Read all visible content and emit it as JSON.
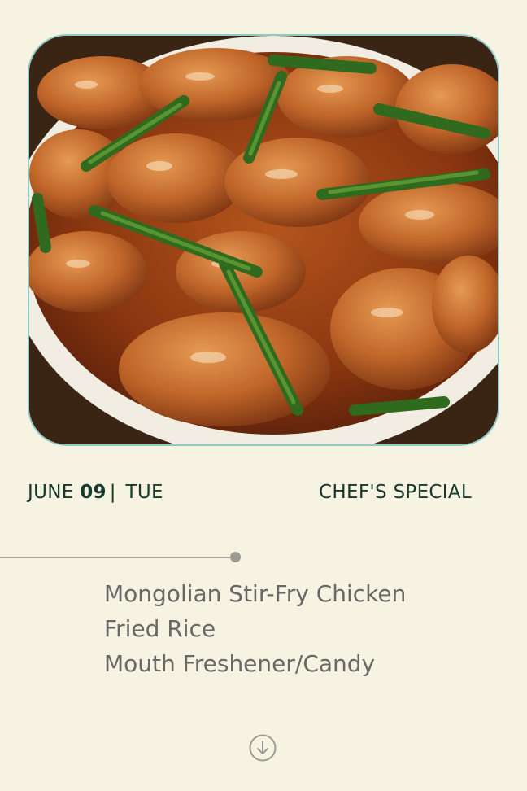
{
  "header": {
    "month": "JUNE",
    "day": "09",
    "separator": "|",
    "weekday": "TUE",
    "tag": "CHEF'S SPECIAL"
  },
  "menu": {
    "items": [
      "Mongolian Stir-Fry Chicken",
      "Fried Rice",
      "Mouth Freshener/Candy"
    ]
  },
  "icons": {
    "scroll": "arrow-down-circle-icon"
  },
  "colors": {
    "background": "#f6f3e2",
    "heading": "#17392e",
    "menu_text": "#686866",
    "image_border": "#8fcac7"
  }
}
